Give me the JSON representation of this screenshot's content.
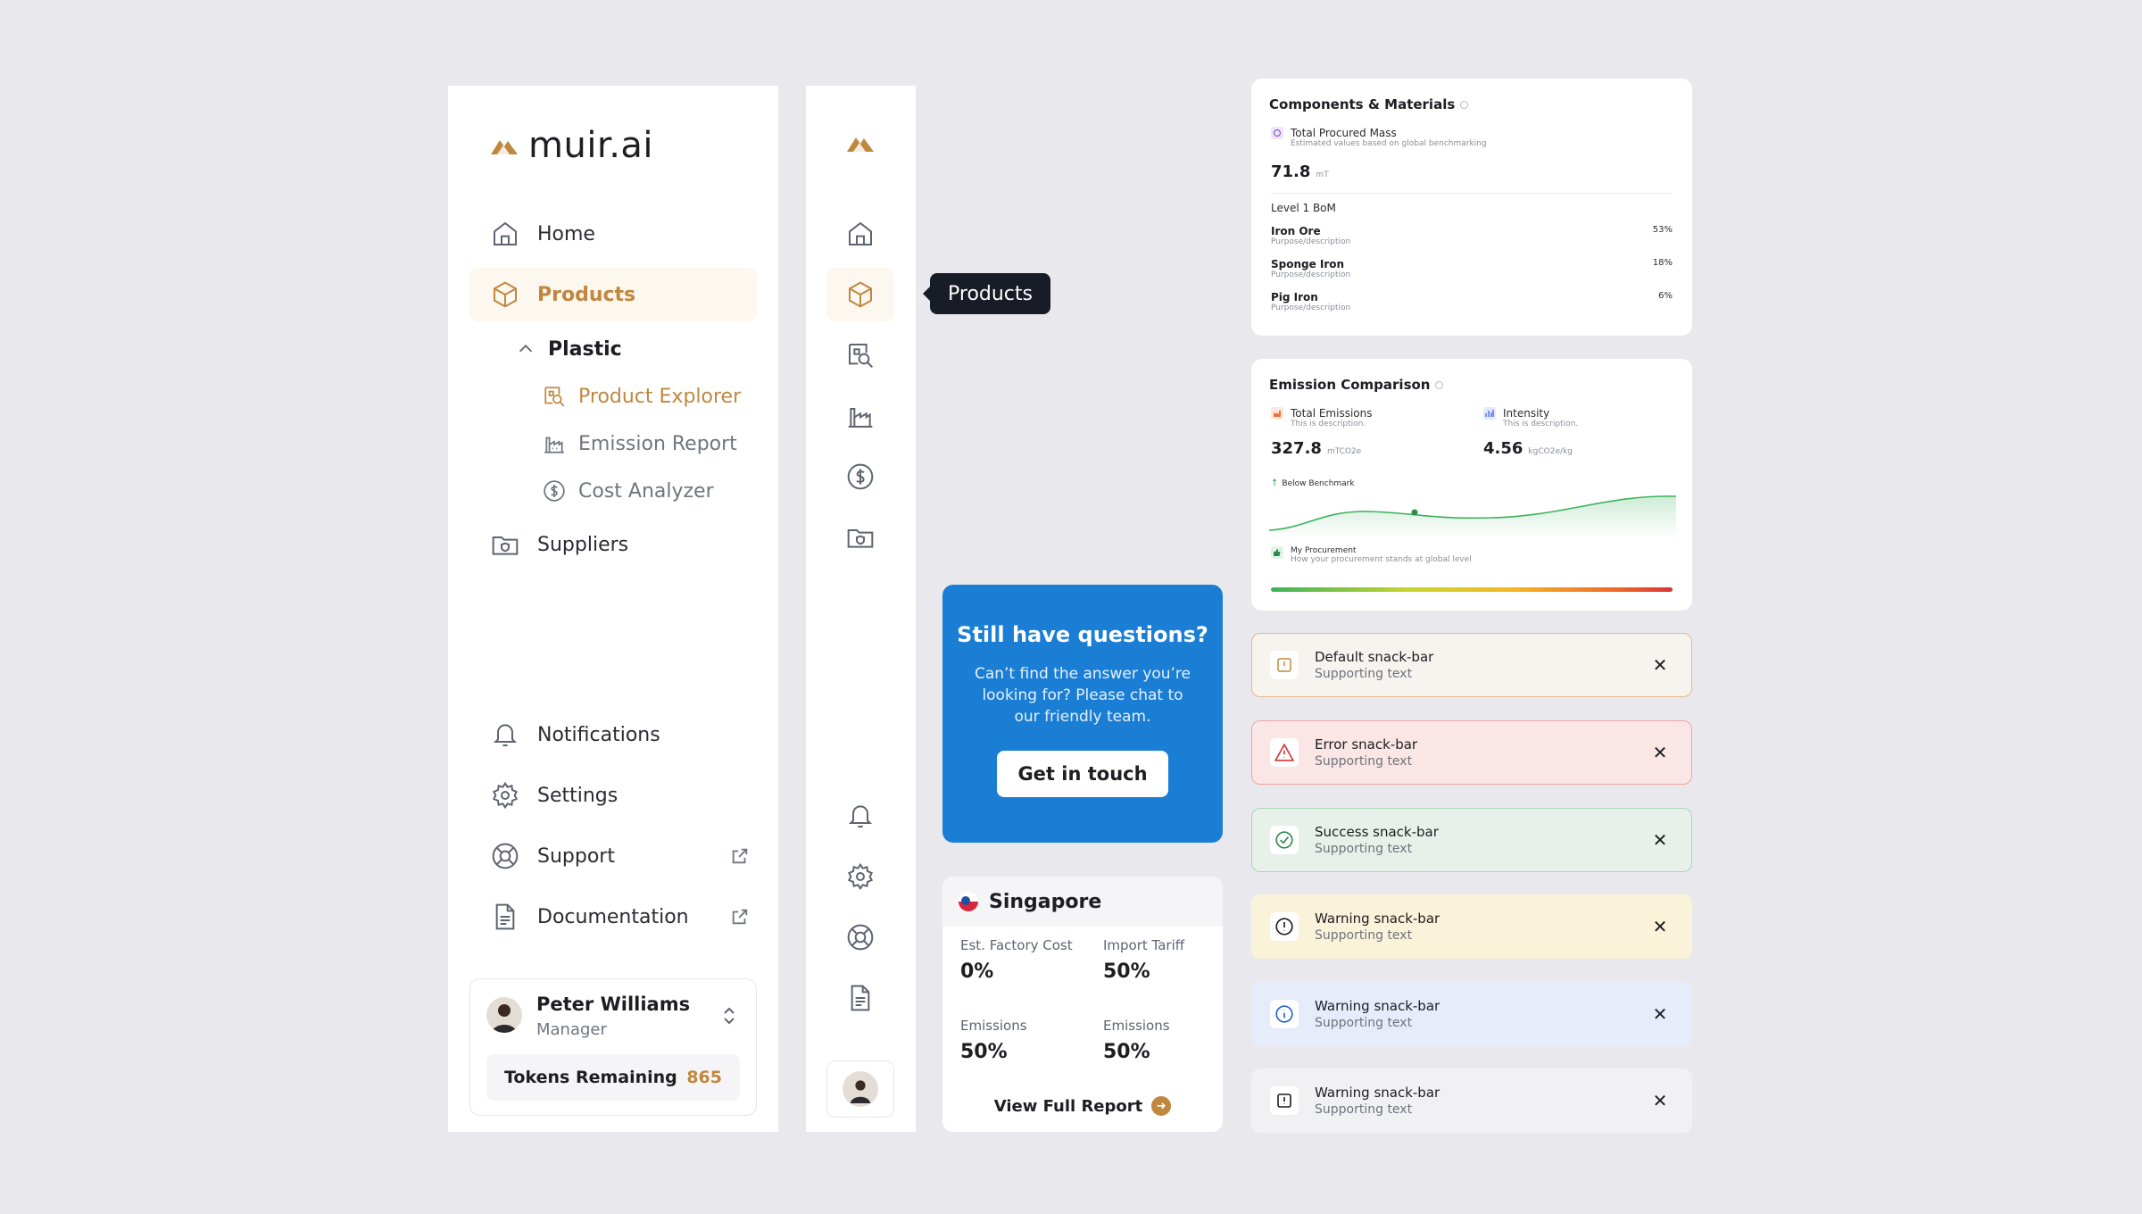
{
  "brand": {
    "name": "muir.ai",
    "accent": "#c0873f"
  },
  "sidebar": {
    "items": [
      {
        "label": "Home",
        "icon": "home-icon"
      },
      {
        "label": "Products",
        "icon": "cube-icon",
        "active": true
      },
      {
        "label": "Suppliers",
        "icon": "folder-shield-icon"
      }
    ],
    "group": {
      "label": "Plastic",
      "icon": "chevron-up-icon"
    },
    "sub_items": [
      {
        "label": "Product Explorer",
        "icon": "search-doc-icon",
        "active": true
      },
      {
        "label": "Emission Report",
        "icon": "factory-icon"
      },
      {
        "label": "Cost Analyzer",
        "icon": "dollar-icon"
      }
    ],
    "bottom_items": [
      {
        "label": "Notifications",
        "icon": "bell-icon"
      },
      {
        "label": "Settings",
        "icon": "gear-icon"
      },
      {
        "label": "Support",
        "icon": "lifebuoy-icon"
      },
      {
        "label": "Documentation",
        "icon": "document-icon"
      }
    ],
    "user": {
      "name": "Peter Williams",
      "role": "Manager",
      "tokens_label": "Tokens Remaining",
      "tokens_value": "865"
    }
  },
  "rail": {
    "tooltip": "Products"
  },
  "questions": {
    "title": "Still have questions?",
    "text": "Can’t find the answer you’re looking for? Please chat to our friendly team.",
    "button": "Get in touch"
  },
  "country": {
    "name": "Singapore",
    "stats": [
      {
        "label": "Est. Factory Cost",
        "value": "0%"
      },
      {
        "label": "Import Tariff",
        "value": "50%"
      },
      {
        "label": "Emissions",
        "value": "50%"
      },
      {
        "label": "Emissions",
        "value": "50%"
      }
    ],
    "link": "View Full Report"
  },
  "components": {
    "title": "Components & Materials",
    "metric_label": "Total Procured Mass",
    "metric_desc": "Estimated values based on global benchmarking",
    "metric_value": "71.8",
    "metric_unit": "mT",
    "section": "Level 1 BoM",
    "rows": [
      {
        "name": "Iron Ore",
        "desc": "Purpose/description",
        "pct": "53%"
      },
      {
        "name": "Sponge Iron",
        "desc": "Purpose/description",
        "pct": "18%"
      },
      {
        "name": "Pig Iron",
        "desc": "Purpose/description",
        "pct": "6%"
      }
    ]
  },
  "emission": {
    "title": "Emission Comparison",
    "total_label": "Total Emissions",
    "total_desc": "This is description.",
    "total_value": "327.8",
    "total_unit": "mTCO2e",
    "intensity_label": "Intensity",
    "intensity_desc": "This is description.",
    "intensity_value": "4.56",
    "intensity_unit": "kgCO2e/kg",
    "benchmark": "Below Benchmark",
    "proc_label": "My Procurement",
    "proc_desc": "How your procurement stands at global level"
  },
  "snackbars": [
    {
      "title": "Default snack-bar",
      "text": "Supporting text",
      "kind": "default",
      "bg": "#f7f3ee",
      "border": "#e6b78a",
      "icon_color": "#c0873f"
    },
    {
      "title": "Error snack-bar",
      "text": "Supporting text",
      "kind": "error",
      "bg": "#fbe6e6",
      "border": "#efa3a3",
      "icon_color": "#d93636"
    },
    {
      "title": "Success snack-bar",
      "text": "Supporting text",
      "kind": "success",
      "bg": "#e7f1ea",
      "border": "#a9d4b5",
      "icon_color": "#2e8b4e"
    },
    {
      "title": "Warning snack-bar",
      "text": "Supporting text",
      "kind": "warning",
      "bg": "#fbf2da",
      "border": "#fbf2da",
      "icon_color": "#1d1d22"
    },
    {
      "title": "Warning snack-bar",
      "text": "Supporting text",
      "kind": "info",
      "bg": "#e6ecfa",
      "border": "#e6ecfa",
      "icon_color": "#2563c9"
    },
    {
      "title": "Warning snack-bar",
      "text": "Supporting text",
      "kind": "neutral",
      "bg": "#f1f1f3",
      "border": "#f1f1f3",
      "icon_color": "#1d1d22"
    }
  ]
}
